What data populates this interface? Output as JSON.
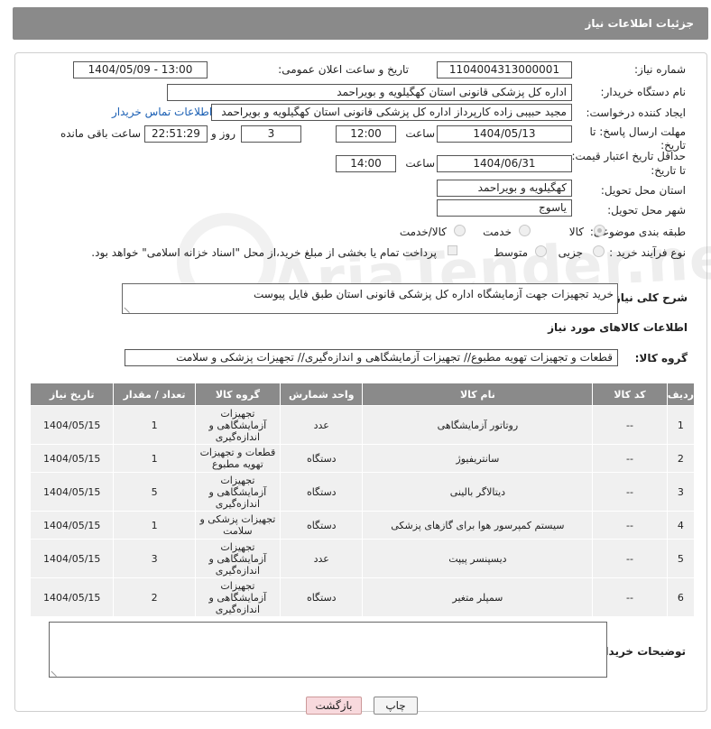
{
  "header": {
    "title": "جزئیات اطلاعات نیاز"
  },
  "form": {
    "need_number_label": "شماره نیاز:",
    "need_number": "1104004313000001",
    "announce_label": "تاریخ و ساعت اعلان عمومی:",
    "announce_value": "1404/05/09 - 13:00",
    "buyer_org_label": "نام دستگاه خریدار:",
    "buyer_org": "اداره کل پزشکی قانونی استان کهگیلویه و بویراحمد",
    "creator_label": "ایجاد کننده درخواست:",
    "creator": "مجید حبیبی زاده کارپرداز اداره کل پزشکی قانونی استان کهگیلویه و بویراحمد",
    "contact_link": "اطلاعات تماس خریدار",
    "deadline_label_1": "مهلت ارسال پاسخ: تا",
    "deadline_label_2": "تاریخ:",
    "deadline_date": "1404/05/13",
    "time_label": "ساعت",
    "deadline_time": "12:00",
    "days_value": "3",
    "days_label": "روز و",
    "remaining_time": "22:51:29",
    "remaining_label": "ساعت باقی مانده",
    "validity_label_1": "حداقل تاریخ اعتبار قیمت:",
    "validity_label_2": "تا تاریخ:",
    "validity_date": "1404/06/31",
    "validity_time": "14:00",
    "province_label": "استان محل تحویل:",
    "province": "کهگیلویه و بویراحمد",
    "city_label": "شهر محل تحویل:",
    "city": "یاسوج",
    "category_label": "طبقه بندی موضوعی:",
    "category_options": [
      "کالا",
      "خدمت",
      "کالا/خدمت"
    ],
    "process_label": "نوع فرآیند خرید :",
    "process_options": [
      "جزیی",
      "متوسط"
    ],
    "payment_note": "پرداخت تمام یا بخشی از مبلغ خرید،از محل \"اسناد خزانه اسلامی\" خواهد بود.",
    "description_label": "شرح کلی نیاز:",
    "description": "خرید تجهیزات جهت آزمایشگاه اداره کل پزشکی قانونی استان طبق فایل پیوست",
    "goods_info_title": "اطلاعات کالاهای مورد نیاز",
    "goods_group_label": "گروه کالا:",
    "goods_group": "قطعات و تجهیزات تهویه مطبوع// تجهیزات آزمایشگاهی و اندازه‌گیری// تجهیزات پزشکی و سلامت",
    "buyer_notes_label": "توضیحات خریدار:"
  },
  "table": {
    "headers": [
      "ردیف",
      "کد کالا",
      "نام کالا",
      "واحد شمارش",
      "گروه کالا",
      "تعداد / مقدار",
      "تاریخ نیاز"
    ],
    "rows": [
      [
        "1",
        "--",
        "روتاتور آزمایشگاهی",
        "عدد",
        "تجهیزات آزمایشگاهی و اندازه‌گیری",
        "1",
        "1404/05/15"
      ],
      [
        "2",
        "--",
        "سانتریفیوژ",
        "دستگاه",
        "قطعات و تجهیزات تهویه مطبوع",
        "1",
        "1404/05/15"
      ],
      [
        "3",
        "--",
        "دیتالاگر بالینی",
        "دستگاه",
        "تجهیزات آزمایشگاهی و اندازه‌گیری",
        "5",
        "1404/05/15"
      ],
      [
        "4",
        "--",
        "سیستم کمپرسور هوا برای گازهای پزشکی",
        "دستگاه",
        "تجهیزات پزشکی و سلامت",
        "1",
        "1404/05/15"
      ],
      [
        "5",
        "--",
        "دیسپنسر پیپت",
        "عدد",
        "تجهیزات آزمایشگاهی و اندازه‌گیری",
        "3",
        "1404/05/15"
      ],
      [
        "6",
        "--",
        "سمپلر متغیر",
        "دستگاه",
        "تجهیزات آزمایشگاهی و اندازه‌گیری",
        "2",
        "1404/05/15"
      ]
    ]
  },
  "buttons": {
    "print": "چاپ",
    "back": "بازگشت"
  },
  "watermark": "AriaTender.net"
}
